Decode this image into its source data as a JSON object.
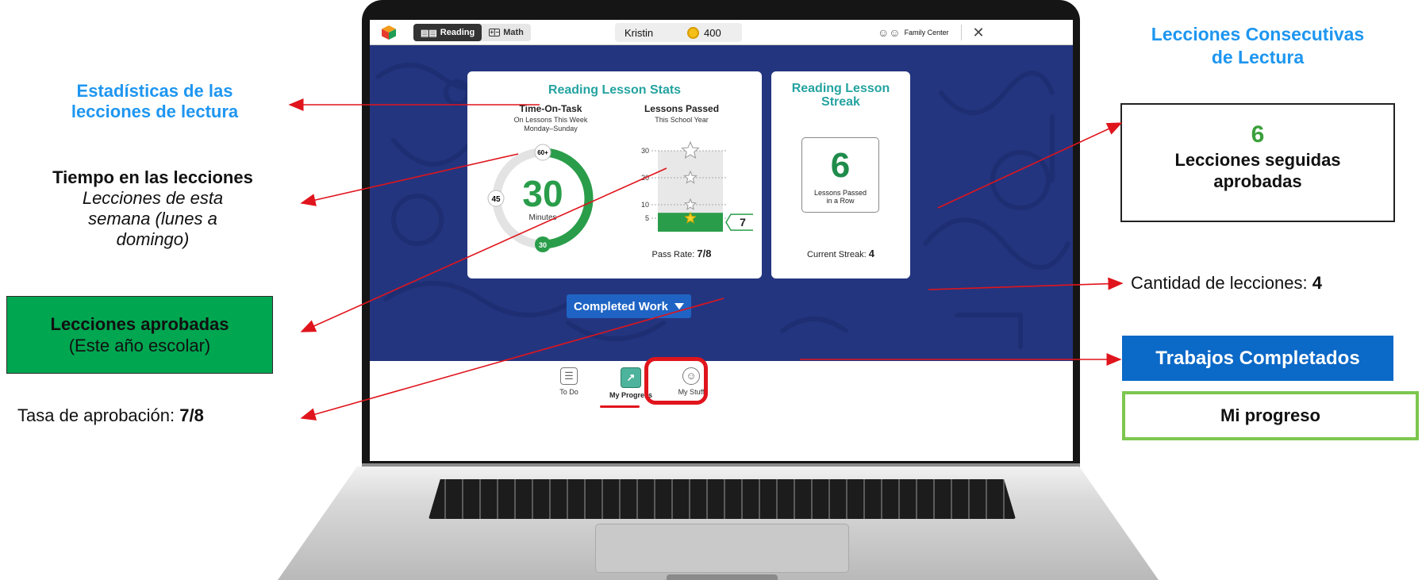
{
  "app": {
    "tabs": [
      {
        "label": "Reading",
        "active": true,
        "icon": "book-icon"
      },
      {
        "label": "Math",
        "active": false,
        "icon": "plus-minus-icon"
      }
    ],
    "user_name": "Kristin",
    "coins": "400",
    "family_center": "Family Center",
    "close_icon": "close-icon"
  },
  "stats_card": {
    "title": "Reading Lesson Stats",
    "time_on_task": {
      "heading": "Time-On-Task",
      "sub1": "On Lessons This Week",
      "sub2": "Monday–Sunday",
      "minutes": "30",
      "unit": "Minutes",
      "mark_60": "60+",
      "mark_45": "45",
      "mark_30": "30",
      "progress_fraction": 0.5
    },
    "lessons_passed": {
      "heading": "Lessons Passed",
      "sub": "This School Year",
      "count": "7",
      "pass_rate_label": "Pass Rate:",
      "pass_rate_value": "7/8"
    }
  },
  "streak_card": {
    "title_line1": "Reading Lesson",
    "title_line2": "Streak",
    "count": "6",
    "label_line1": "Lessons Passed",
    "label_line2": "in a Row",
    "current_label": "Current Streak:",
    "current_value": "4"
  },
  "completed_work_button": "Completed Work",
  "nav": [
    {
      "label": "To Do",
      "icon": "checklist-icon"
    },
    {
      "label": "My Progress",
      "icon": "arrow-up-right-icon",
      "active": true
    },
    {
      "label": "My Stuff",
      "icon": "smiley-icon"
    }
  ],
  "chart_data": {
    "type": "bar",
    "categories": [
      "Lessons Passed"
    ],
    "values": [
      7
    ],
    "ylim": [
      0,
      30
    ],
    "ytick_labels": [
      "5",
      "10",
      "20",
      "30"
    ],
    "ytick_values": [
      5,
      10,
      20,
      30
    ],
    "star_levels": [
      5,
      10,
      20,
      30
    ],
    "data_label": "7"
  },
  "annotations": {
    "stats_title_l1": "Estadísticas de las",
    "stats_title_l2": "lecciones de lectura",
    "time_l1": "Tiempo en las lecciones",
    "time_l2": "Lecciones de esta",
    "time_l3": "semana (lunes a",
    "time_l4": "domingo)",
    "passed_l1": "Lecciones aprobadas",
    "passed_l2": "(Este año escolar)",
    "rate_label": "Tasa de aprobación: ",
    "rate_value": "7/8",
    "streak_title_l1": "Lecciones Consecutivas",
    "streak_title_l2": "de Lectura",
    "streak_num": "6",
    "streak_l1": "Lecciones seguidas",
    "streak_l2": "aprobadas",
    "count_label": "Cantidad de lecciones: ",
    "count_value": "4",
    "completed": "Trabajos Completados",
    "progress": "Mi progreso"
  },
  "colors": {
    "accent_teal": "#24a3a0",
    "green": "#1f8c4b",
    "annotation_blue": "#1e96f0",
    "arrow_red": "#e0141c",
    "button_blue": "#1f64c4"
  }
}
